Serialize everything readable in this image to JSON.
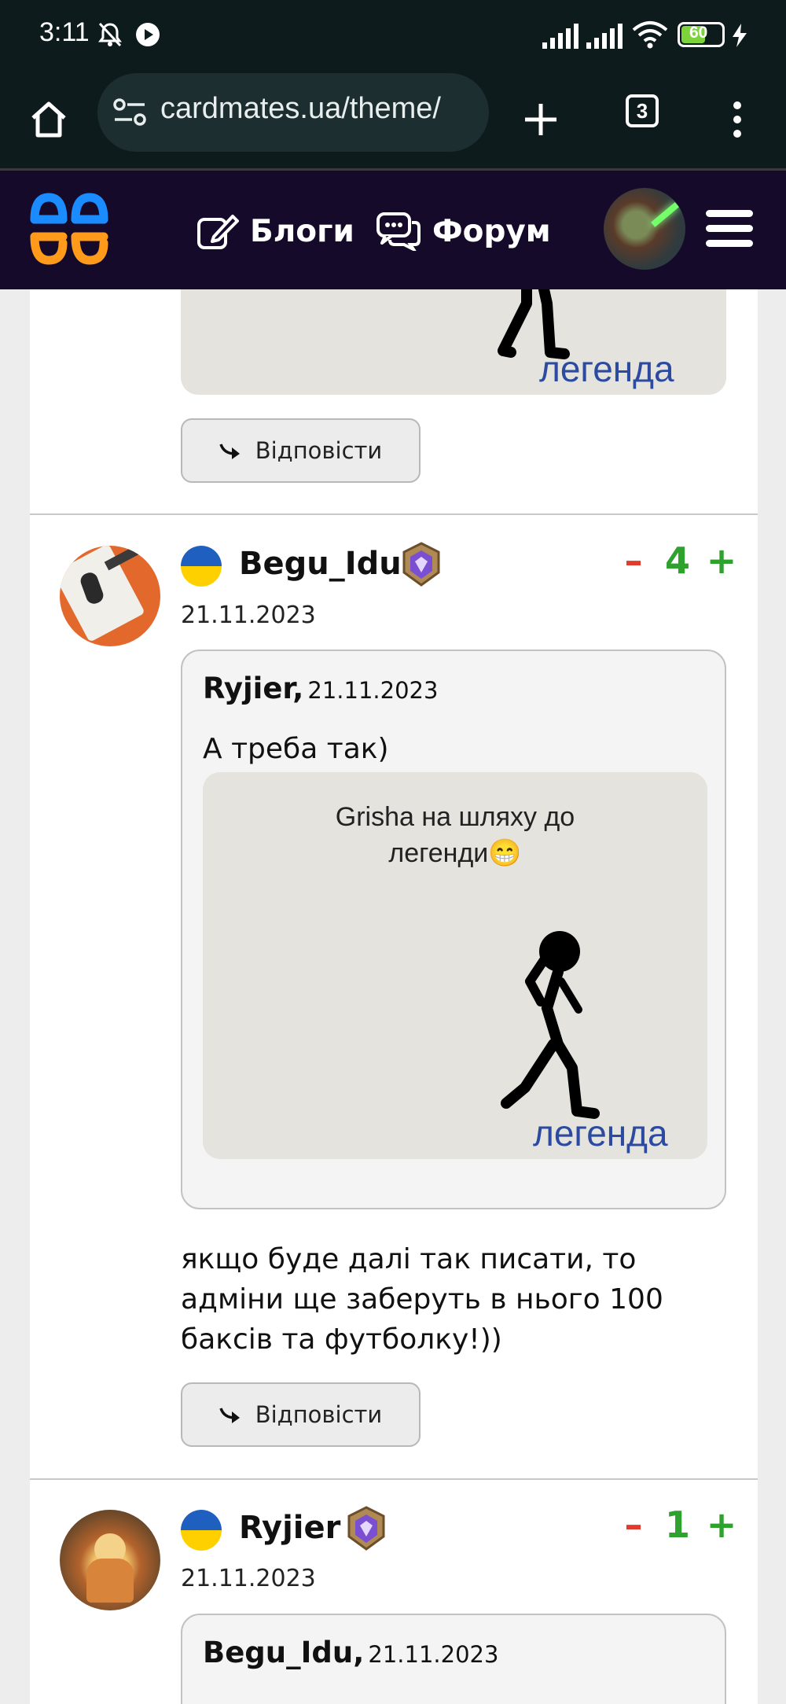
{
  "status_bar": {
    "time": "3:11",
    "battery": "60"
  },
  "browser": {
    "url": "cardmates.ua/theme/",
    "tab_count": "3"
  },
  "site_nav": {
    "blogs_label": "Блоги",
    "forum_label": "Форум"
  },
  "prev_comment": {
    "image_text": "легенда",
    "reply_label": "Відповісти"
  },
  "comments": [
    {
      "author": "Begu_Idu",
      "date": "21.11.2023",
      "score": "4",
      "minus": "–",
      "plus": "+",
      "quote": {
        "author": "Ryjier",
        "separator": ",",
        "date": "21.11.2023",
        "text": "А треба так)",
        "image_caption_line1": "Grisha на шляху до",
        "image_caption_line2": "легенди😁",
        "image_text": "легенда"
      },
      "body": "якщо буде далі так писати, то адміни ще заберуть в нього 100 баксів та футболку!))",
      "reply_label": "Відповісти"
    },
    {
      "author": "Ryjier",
      "date": "21.11.2023",
      "score": "1",
      "minus": "–",
      "plus": "+",
      "quote": {
        "author": "Begu_Idu",
        "separator": ",",
        "date": "21.11.2023"
      }
    }
  ],
  "colors": {
    "site_header_bg": "#160a2a",
    "browser_bg": "#0d1b1c",
    "vote_minus": "#e23b2e",
    "vote_plus": "#2ea12e",
    "logo_blue": "#1a8cff",
    "logo_orange": "#ff9a1a"
  }
}
